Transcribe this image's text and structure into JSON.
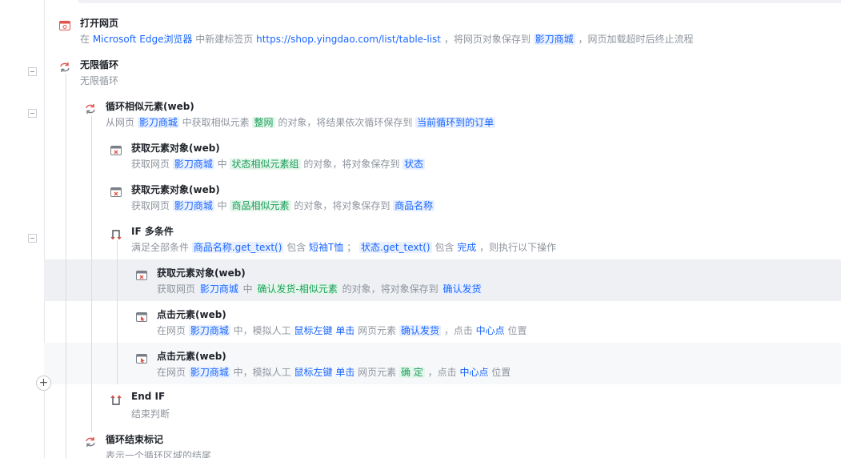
{
  "steps": [
    {
      "id": "open_page",
      "icon": "browser-open-icon",
      "title": "打开网页",
      "desc": [
        {
          "t": "在 "
        },
        {
          "t": "Microsoft Edge浏览器",
          "k": "kw"
        },
        {
          "t": " 中新建标签页 "
        },
        {
          "t": "https://shop.yingdao.com/list/table-list",
          "k": "kw"
        },
        {
          "t": " ，将网页对象保存到 "
        },
        {
          "t": "影刀商城",
          "k": "var"
        },
        {
          "t": " ，网页加载超时后终止流程"
        }
      ]
    },
    {
      "id": "infinite_loop",
      "icon": "loop-icon",
      "title": "无限循环",
      "desc": [
        {
          "t": "无限循环"
        }
      ]
    },
    {
      "id": "loop_similar",
      "icon": "loop-icon",
      "title": "循环相似元素(web)",
      "desc": [
        {
          "t": "从网页 "
        },
        {
          "t": "影刀商城",
          "k": "var"
        },
        {
          "t": " 中获取相似元素 "
        },
        {
          "t": "整网",
          "k": "el"
        },
        {
          "t": " 的对象，将结果依次循环保存到 "
        },
        {
          "t": "当前循环到的订单",
          "k": "var"
        }
      ]
    },
    {
      "id": "get_elem_1",
      "icon": "web-element-icon",
      "title": "获取元素对象(web)",
      "desc": [
        {
          "t": "获取网页 "
        },
        {
          "t": "影刀商城",
          "k": "var"
        },
        {
          "t": " 中 "
        },
        {
          "t": "状态相似元素组",
          "k": "el"
        },
        {
          "t": " 的对象，将对象保存到 "
        },
        {
          "t": "状态",
          "k": "var"
        }
      ]
    },
    {
      "id": "get_elem_2",
      "icon": "web-element-icon",
      "title": "获取元素对象(web)",
      "desc": [
        {
          "t": "获取网页 "
        },
        {
          "t": "影刀商城",
          "k": "var"
        },
        {
          "t": " 中 "
        },
        {
          "t": "商品相似元素",
          "k": "el"
        },
        {
          "t": " 的对象，将对象保存到 "
        },
        {
          "t": "商品名称",
          "k": "var"
        }
      ]
    },
    {
      "id": "if_multi",
      "icon": "if-branch-icon",
      "title": "IF 多条件",
      "desc": [
        {
          "t": "满足全部条件 "
        },
        {
          "t": "商品名称.get_text()",
          "k": "var"
        },
        {
          "t": " 包含 "
        },
        {
          "t": "短袖T恤",
          "k": "kw"
        },
        {
          "t": " ； "
        },
        {
          "t": "状态.get_text()",
          "k": "var"
        },
        {
          "t": " 包含 "
        },
        {
          "t": "完成",
          "k": "kw"
        },
        {
          "t": " ，则执行以下操作"
        }
      ]
    },
    {
      "id": "get_elem_3",
      "icon": "web-element-icon",
      "title": "获取元素对象(web)",
      "desc": [
        {
          "t": "获取网页 "
        },
        {
          "t": "影刀商城",
          "k": "var"
        },
        {
          "t": " 中 "
        },
        {
          "t": "确认发货-相似元素",
          "k": "el"
        },
        {
          "t": " 的对象，将对象保存到 "
        },
        {
          "t": "确认发货",
          "k": "var"
        }
      ]
    },
    {
      "id": "click_1",
      "icon": "click-element-icon",
      "title": "点击元素(web)",
      "desc": [
        {
          "t": "在网页 "
        },
        {
          "t": "影刀商城",
          "k": "var"
        },
        {
          "t": " 中，模拟人工 "
        },
        {
          "t": "鼠标左键",
          "k": "kw"
        },
        {
          "t": " "
        },
        {
          "t": "单击",
          "k": "kw"
        },
        {
          "t": " 网页元素 "
        },
        {
          "t": "确认发货",
          "k": "var"
        },
        {
          "t": " ，点击 "
        },
        {
          "t": "中心点",
          "k": "kw"
        },
        {
          "t": " 位置"
        }
      ]
    },
    {
      "id": "click_2",
      "icon": "click-element-icon",
      "title": "点击元素(web)",
      "desc": [
        {
          "t": "在网页 "
        },
        {
          "t": "影刀商城",
          "k": "var"
        },
        {
          "t": " 中，模拟人工 "
        },
        {
          "t": "鼠标左键",
          "k": "kw"
        },
        {
          "t": " "
        },
        {
          "t": "单击",
          "k": "kw"
        },
        {
          "t": " 网页元素 "
        },
        {
          "t": "确 定",
          "k": "el"
        },
        {
          "t": " ，点击 "
        },
        {
          "t": "中心点",
          "k": "kw"
        },
        {
          "t": " 位置"
        }
      ]
    },
    {
      "id": "end_if",
      "icon": "end-if-icon",
      "title": "End IF",
      "desc": [
        {
          "t": "结束判断"
        }
      ]
    },
    {
      "id": "loop_end",
      "icon": "loop-icon",
      "title": "循环结束标记",
      "desc": [
        {
          "t": "表示一个循环区域的结尾"
        }
      ]
    }
  ],
  "add_button_label": "+"
}
